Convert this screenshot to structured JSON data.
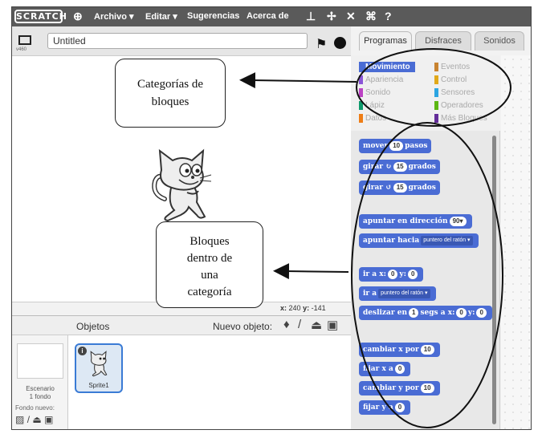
{
  "menubar": {
    "logo": "SCRATCH",
    "items": [
      "Archivo ▾",
      "Editar ▾",
      "Sugerencias",
      "Acerca de"
    ],
    "icons": [
      "globe-icon",
      "stamp-icon",
      "scissors-icon",
      "grow-icon",
      "shrink-icon",
      "help-icon"
    ]
  },
  "stage_toolbar": {
    "version": "v460",
    "project_title": "Untitled"
  },
  "stage": {
    "coords_x_label": "x:",
    "coords_x": "240",
    "coords_y_label": "y:",
    "coords_y": "-141"
  },
  "tabs": [
    "Programas",
    "Disfraces",
    "Sonidos"
  ],
  "categories": {
    "left": [
      "Movimiento",
      "Apariencia",
      "Sonido",
      "Lápiz",
      "Datos"
    ],
    "right": [
      "Eventos",
      "Control",
      "Sensores",
      "Operadores",
      "Más Bloques"
    ],
    "active": "Movimiento"
  },
  "blocks": [
    {
      "parts": [
        "mover",
        "10",
        "pasos"
      ]
    },
    {
      "parts": [
        "girar ↻",
        "15",
        "grados"
      ]
    },
    {
      "parts": [
        "girar ↺",
        "15",
        "grados"
      ]
    },
    {
      "parts": [
        "apuntar en dirección",
        "90▾"
      ]
    },
    {
      "parts": [
        "apuntar hacia",
        "puntero del ratón ▾"
      ]
    },
    {
      "parts": [
        "ir a x:",
        "0",
        "y:",
        "0"
      ]
    },
    {
      "parts": [
        "ir a",
        "puntero del ratón ▾"
      ]
    },
    {
      "parts": [
        "deslizar en",
        "1",
        "segs a x:",
        "0",
        "y:",
        "0"
      ]
    },
    {
      "parts": [
        "cambiar x por",
        "10"
      ]
    },
    {
      "parts": [
        "fijar x a",
        "0"
      ]
    },
    {
      "parts": [
        "cambiar y por",
        "10"
      ]
    },
    {
      "parts": [
        "fijar y a",
        "0"
      ]
    }
  ],
  "sprite_pane": {
    "title": "Objetos",
    "new_sprite_label": "Nuevo objeto:",
    "stage_name": "Escenario",
    "stage_backdrops": "1 fondo",
    "new_backdrop_label": "Fondo nuevo:",
    "sprite_name": "Sprite1"
  },
  "annotations": {
    "categories_line1": "Categorías de",
    "categories_line2": "bloques",
    "blocks_line1": "Bloques",
    "blocks_line2": "dentro de",
    "blocks_line3": "una",
    "blocks_line4": "categoría"
  },
  "colors": {
    "menubar": "#5a5a5a",
    "motion": "#4a6cd4",
    "looks": "#8a55d7",
    "sound": "#bb42c3",
    "pen": "#0e9a6c",
    "data": "#ee7d16",
    "events": "#c88330",
    "control": "#e1a91a",
    "sensing": "#2ca5e2",
    "operators": "#5cb712",
    "more": "#632d99"
  }
}
